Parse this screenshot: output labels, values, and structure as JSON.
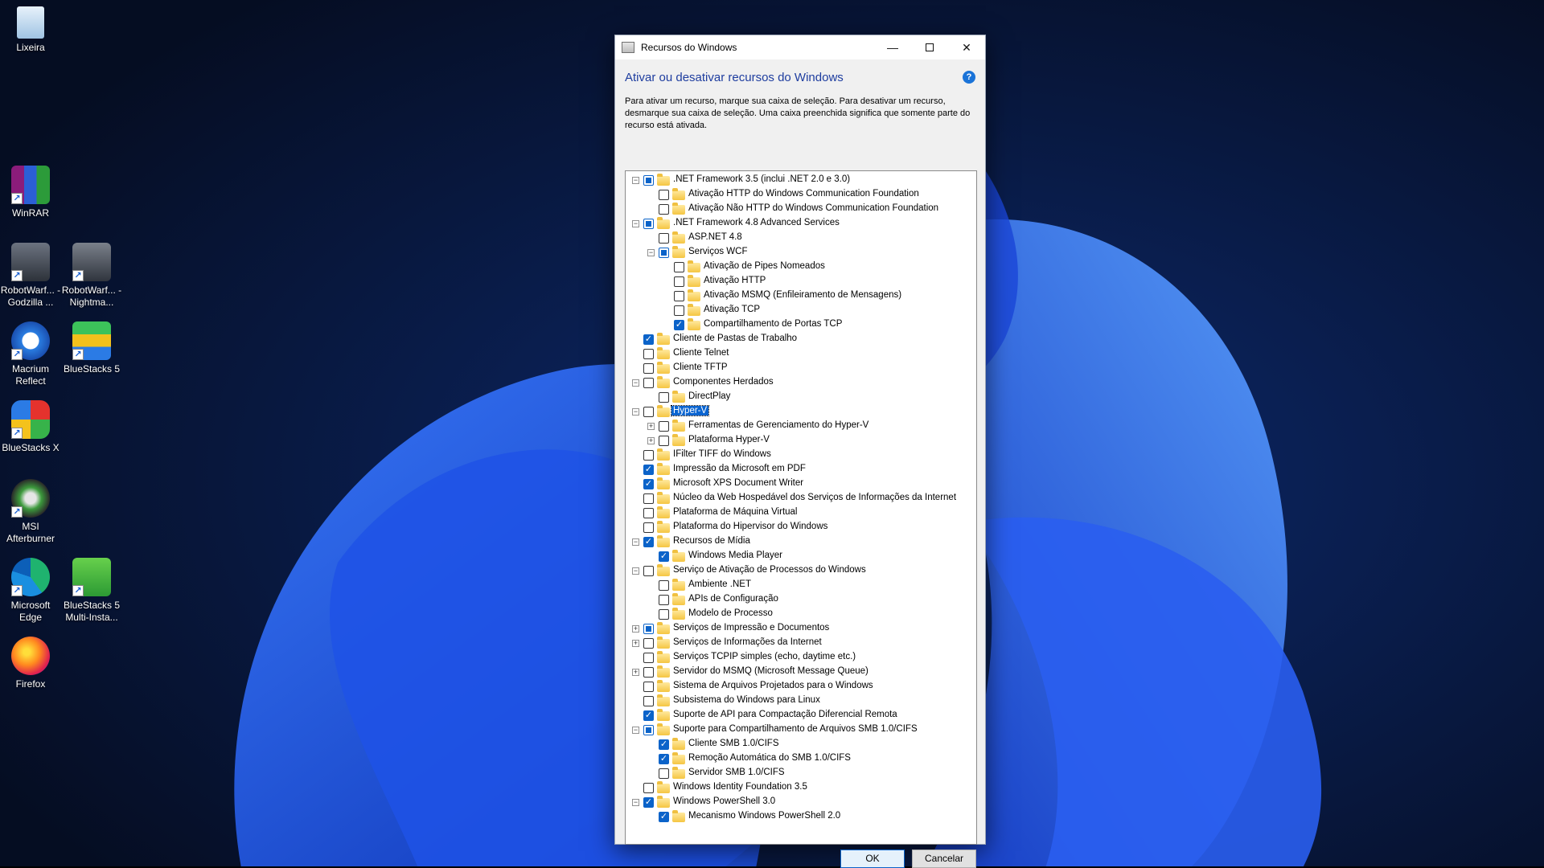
{
  "desktop": {
    "icons": [
      {
        "label": "Lixeira",
        "icon": "recycle-bin-icon"
      },
      {
        "label": "WinRAR",
        "icon": "winrar-icon"
      },
      {
        "label": "RobotWarf... - Godzilla ...",
        "icon": "robotwarfare-icon"
      },
      {
        "label": "RobotWarf... - Nightma...",
        "icon": "robotwarfare-icon"
      },
      {
        "label": "Macrium Reflect",
        "icon": "macrium-reflect-icon"
      },
      {
        "label": "BlueStacks 5",
        "icon": "bluestacks-icon"
      },
      {
        "label": "BlueStacks X",
        "icon": "bluestacks-x-icon"
      },
      {
        "label": "MSI Afterburner",
        "icon": "msi-afterburner-icon"
      },
      {
        "label": "Microsoft Edge",
        "icon": "edge-icon"
      },
      {
        "label": "BlueStacks 5 Multi-Insta...",
        "icon": "bluestacks-multi-icon"
      },
      {
        "label": "Firefox",
        "icon": "firefox-icon"
      }
    ]
  },
  "dialog": {
    "title": "Recursos do Windows",
    "heading": "Ativar ou desativar recursos do Windows",
    "description": "Para ativar um recurso, marque sua caixa de seleção. Para desativar um recurso, desmarque sua caixa de seleção. Uma caixa preenchida significa que somente parte do recurso está ativada.",
    "ok_label": "OK",
    "cancel_label": "Cancelar",
    "features": [
      {
        "label": ".NET Framework 3.5 (inclui .NET 2.0 e 3.0)",
        "level": 0,
        "expander": "minus",
        "state": "partial"
      },
      {
        "label": "Ativação HTTP do Windows Communication Foundation",
        "level": 1,
        "expander": "",
        "state": "unchecked"
      },
      {
        "label": "Ativação Não HTTP do Windows Communication Foundation",
        "level": 1,
        "expander": "",
        "state": "unchecked"
      },
      {
        "label": ".NET Framework 4.8 Advanced Services",
        "level": 0,
        "expander": "minus",
        "state": "partial"
      },
      {
        "label": "ASP.NET 4.8",
        "level": 1,
        "expander": "",
        "state": "unchecked"
      },
      {
        "label": "Serviços WCF",
        "level": 1,
        "expander": "minus",
        "state": "partial"
      },
      {
        "label": "Ativação de Pipes Nomeados",
        "level": 2,
        "expander": "",
        "state": "unchecked"
      },
      {
        "label": "Ativação HTTP",
        "level": 2,
        "expander": "",
        "state": "unchecked"
      },
      {
        "label": "Ativação MSMQ (Enfileiramento de Mensagens)",
        "level": 2,
        "expander": "",
        "state": "unchecked"
      },
      {
        "label": "Ativação TCP",
        "level": 2,
        "expander": "",
        "state": "unchecked"
      },
      {
        "label": "Compartilhamento de Portas TCP",
        "level": 2,
        "expander": "",
        "state": "checked"
      },
      {
        "label": "Cliente de Pastas de Trabalho",
        "level": 0,
        "expander": "",
        "state": "checked"
      },
      {
        "label": "Cliente Telnet",
        "level": 0,
        "expander": "",
        "state": "unchecked"
      },
      {
        "label": "Cliente TFTP",
        "level": 0,
        "expander": "",
        "state": "unchecked"
      },
      {
        "label": "Componentes Herdados",
        "level": 0,
        "expander": "minus",
        "state": "unchecked"
      },
      {
        "label": "DirectPlay",
        "level": 1,
        "expander": "",
        "state": "unchecked"
      },
      {
        "label": "Hyper-V",
        "level": 0,
        "expander": "minus",
        "state": "unchecked",
        "selected": true
      },
      {
        "label": "Ferramentas de Gerenciamento do Hyper-V",
        "level": 1,
        "expander": "plus",
        "state": "unchecked"
      },
      {
        "label": "Plataforma Hyper-V",
        "level": 1,
        "expander": "plus",
        "state": "unchecked"
      },
      {
        "label": "IFilter TIFF do Windows",
        "level": 0,
        "expander": "",
        "state": "unchecked"
      },
      {
        "label": "Impressão da Microsoft em PDF",
        "level": 0,
        "expander": "",
        "state": "checked"
      },
      {
        "label": "Microsoft XPS Document Writer",
        "level": 0,
        "expander": "",
        "state": "checked"
      },
      {
        "label": "Núcleo da Web Hospedável dos Serviços de Informações da Internet",
        "level": 0,
        "expander": "",
        "state": "unchecked"
      },
      {
        "label": "Plataforma de Máquina Virtual",
        "level": 0,
        "expander": "",
        "state": "unchecked"
      },
      {
        "label": "Plataforma do Hipervisor do Windows",
        "level": 0,
        "expander": "",
        "state": "unchecked"
      },
      {
        "label": "Recursos de Mídia",
        "level": 0,
        "expander": "minus",
        "state": "checked"
      },
      {
        "label": "Windows Media Player",
        "level": 1,
        "expander": "",
        "state": "checked"
      },
      {
        "label": "Serviço de Ativação de Processos do Windows",
        "level": 0,
        "expander": "minus",
        "state": "unchecked"
      },
      {
        "label": "Ambiente .NET",
        "level": 1,
        "expander": "",
        "state": "unchecked"
      },
      {
        "label": "APIs de Configuração",
        "level": 1,
        "expander": "",
        "state": "unchecked"
      },
      {
        "label": "Modelo de Processo",
        "level": 1,
        "expander": "",
        "state": "unchecked"
      },
      {
        "label": "Serviços de Impressão e Documentos",
        "level": 0,
        "expander": "plus",
        "state": "partial"
      },
      {
        "label": "Serviços de Informações da Internet",
        "level": 0,
        "expander": "plus",
        "state": "unchecked"
      },
      {
        "label": "Serviços TCPIP simples (echo, daytime etc.)",
        "level": 0,
        "expander": "",
        "state": "unchecked"
      },
      {
        "label": "Servidor do MSMQ (Microsoft Message Queue)",
        "level": 0,
        "expander": "plus",
        "state": "unchecked"
      },
      {
        "label": "Sistema de Arquivos Projetados para o Windows",
        "level": 0,
        "expander": "",
        "state": "unchecked"
      },
      {
        "label": "Subsistema do Windows para Linux",
        "level": 0,
        "expander": "",
        "state": "unchecked"
      },
      {
        "label": "Suporte de API para Compactação Diferencial Remota",
        "level": 0,
        "expander": "",
        "state": "checked"
      },
      {
        "label": "Suporte para Compartilhamento de Arquivos SMB 1.0/CIFS",
        "level": 0,
        "expander": "minus",
        "state": "partial"
      },
      {
        "label": "Cliente SMB 1.0/CIFS",
        "level": 1,
        "expander": "",
        "state": "checked"
      },
      {
        "label": "Remoção Automática do SMB 1.0/CIFS",
        "level": 1,
        "expander": "",
        "state": "checked"
      },
      {
        "label": "Servidor SMB 1.0/CIFS",
        "level": 1,
        "expander": "",
        "state": "unchecked"
      },
      {
        "label": "Windows Identity Foundation 3.5",
        "level": 0,
        "expander": "",
        "state": "unchecked"
      },
      {
        "label": "Windows PowerShell 3.0",
        "level": 0,
        "expander": "minus",
        "state": "checked"
      },
      {
        "label": "Mecanismo Windows PowerShell 2.0",
        "level": 1,
        "expander": "",
        "state": "checked"
      }
    ]
  },
  "colors": {
    "heading": "#1e3d9f",
    "accent": "#0b63c9",
    "desktop_bg": "#07122b"
  }
}
